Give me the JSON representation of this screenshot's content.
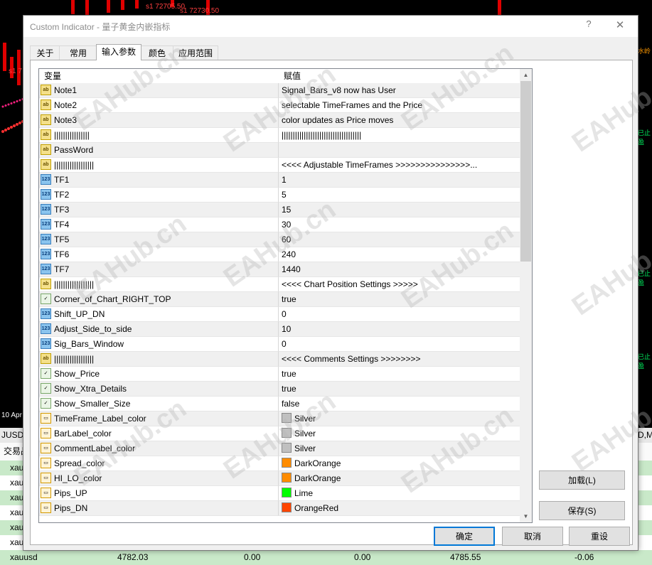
{
  "background": {
    "price_labels": [
      "s1 72705.50",
      "s1 72730.50",
      "s1 7"
    ],
    "date_label": "10 Apr 0",
    "side_labels": [
      "水岭",
      "已止盈",
      "已止盈",
      "已止盈"
    ],
    "symbol_fragment": "JUSD,",
    "symbol_fragment_right": "D,M",
    "terminal_tab": "交易品",
    "terminal_rows": [
      "xau",
      "xau",
      "xau",
      "xau",
      "xau",
      "xau"
    ],
    "last_row": {
      "symbol": "xauusd",
      "v1": "4782.03",
      "v2": "0.00",
      "v3": "0.00",
      "v4": "4785.55",
      "v5": "-0.06"
    }
  },
  "dialog": {
    "title": "Custom Indicator - 量子黄金内嵌指标",
    "help": "?",
    "close": "✕",
    "tabs": [
      "关于",
      "常用",
      "输入参数",
      "颜色",
      "应用范围"
    ],
    "active_tab": 2,
    "grid_header": {
      "variable": "变量",
      "value": "赋值"
    },
    "rows": [
      {
        "type": "ab",
        "name": "Note1",
        "value": "Signal_Bars_v8 now has User"
      },
      {
        "type": "ab",
        "name": "Note2",
        "value": "selectable TimeFrames and the Price"
      },
      {
        "type": "ab",
        "name": "Note3",
        "value": "color updates as Price moves"
      },
      {
        "type": "ab",
        "name": "||||||||||||||||",
        "value": "||||||||||||||||||||||||||||||||||||"
      },
      {
        "type": "ab",
        "name": "PassWord",
        "value": ""
      },
      {
        "type": "ab",
        "name": "||||||||||||||||||",
        "value": "<<<< Adjustable TimeFrames >>>>>>>>>>>>>>>..."
      },
      {
        "type": "num",
        "name": "TF1",
        "value": "1"
      },
      {
        "type": "num",
        "name": "TF2",
        "value": "5"
      },
      {
        "type": "num",
        "name": "TF3",
        "value": "15"
      },
      {
        "type": "num",
        "name": "TF4",
        "value": "30"
      },
      {
        "type": "num",
        "name": "TF5",
        "value": "60"
      },
      {
        "type": "num",
        "name": "TF6",
        "value": "240"
      },
      {
        "type": "num",
        "name": "TF7",
        "value": "1440"
      },
      {
        "type": "ab",
        "name": "||||||||||||||||||",
        "value": "<<<< Chart Position Settings >>>>>"
      },
      {
        "type": "bool",
        "name": "Corner_of_Chart_RIGHT_TOP",
        "value": "true"
      },
      {
        "type": "num",
        "name": "Shift_UP_DN",
        "value": "0"
      },
      {
        "type": "num",
        "name": "Adjust_Side_to_side",
        "value": "10"
      },
      {
        "type": "num",
        "name": "Sig_Bars_Window",
        "value": "0"
      },
      {
        "type": "ab",
        "name": "||||||||||||||||||",
        "value": " <<<< Comments Settings >>>>>>>>"
      },
      {
        "type": "bool",
        "name": "Show_Price",
        "value": "true"
      },
      {
        "type": "bool",
        "name": "Show_Xtra_Details",
        "value": "true"
      },
      {
        "type": "bool",
        "name": "Show_Smaller_Size",
        "value": "false"
      },
      {
        "type": "color",
        "name": "TimeFrame_Label_color",
        "value": "Silver",
        "swatch": "#c0c0c0"
      },
      {
        "type": "color",
        "name": "BarLabel_color",
        "value": "Silver",
        "swatch": "#c0c0c0"
      },
      {
        "type": "color",
        "name": "CommentLabel_color",
        "value": "Silver",
        "swatch": "#c0c0c0"
      },
      {
        "type": "color",
        "name": "Spread_color",
        "value": "DarkOrange",
        "swatch": "#ff8c00"
      },
      {
        "type": "color",
        "name": "HI_LO_color",
        "value": "DarkOrange",
        "swatch": "#ff8c00"
      },
      {
        "type": "color",
        "name": "Pips_UP",
        "value": "Lime",
        "swatch": "#00ff00"
      },
      {
        "type": "color",
        "name": "Pips_DN",
        "value": "OrangeRed",
        "swatch": "#ff4500"
      }
    ],
    "buttons": {
      "load": "加载(L)",
      "save": "保存(S)",
      "ok": "确定",
      "cancel": "取消",
      "reset": "重设"
    },
    "icon_labels": {
      "ab": "ab",
      "num": "123",
      "bool": "✓",
      "color": "▭"
    },
    "watermark": "EAHub.cn",
    "scroll_up": "▲",
    "scroll_down": "▼"
  }
}
